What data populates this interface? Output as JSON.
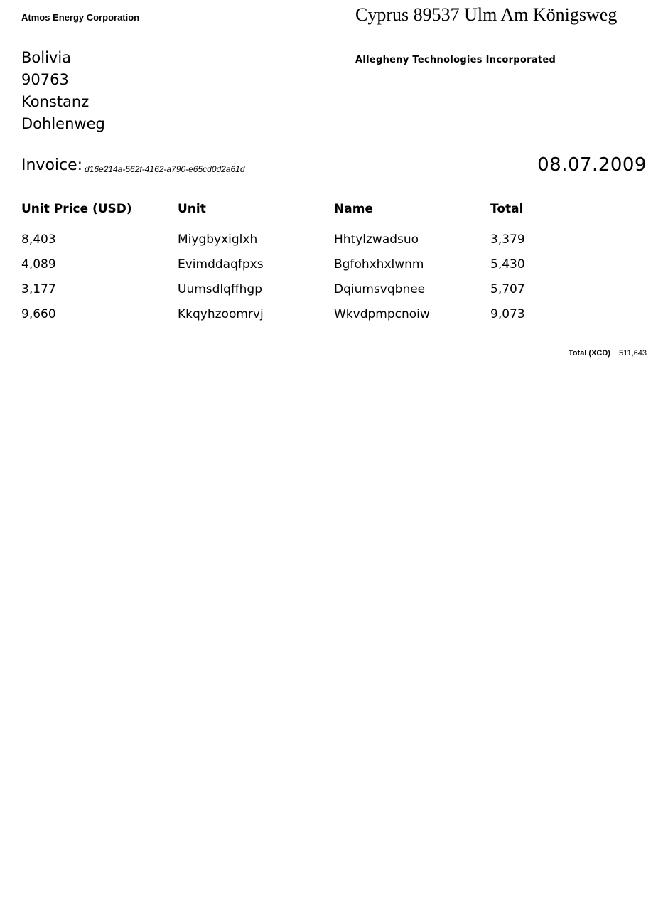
{
  "sender": {
    "name": "Atmos Energy Corporation",
    "address_lines": [
      "Bolivia",
      "90763",
      "Konstanz",
      "Dohlenweg"
    ]
  },
  "recipient": {
    "address": "Cyprus 89537 Ulm Am Königsweg",
    "name": "Allegheny Technologies Incorporated"
  },
  "invoice": {
    "label": "Invoice:",
    "id": "d16e214a-562f-4162-a790-e65cd0d2a61d",
    "date": "08.07.2009"
  },
  "table": {
    "headers": [
      "Unit Price (USD)",
      "Unit",
      "Name",
      "Total"
    ],
    "rows": [
      [
        "8,403",
        "Miygbyxiglxh",
        "Hhtylzwadsuo",
        "3,379"
      ],
      [
        "4,089",
        "Evimddaqfpxs",
        "Bgfohxhxlwnm",
        "5,430"
      ],
      [
        "3,177",
        "Uumsdlqffhgp",
        "Dqiumsvqbnee",
        "5,707"
      ],
      [
        "9,660",
        "Kkqyhzoomrvj",
        "Wkvdpmpcnoiw",
        "9,073"
      ]
    ]
  },
  "total": {
    "label": "Total (XCD)",
    "value": "511,643"
  }
}
